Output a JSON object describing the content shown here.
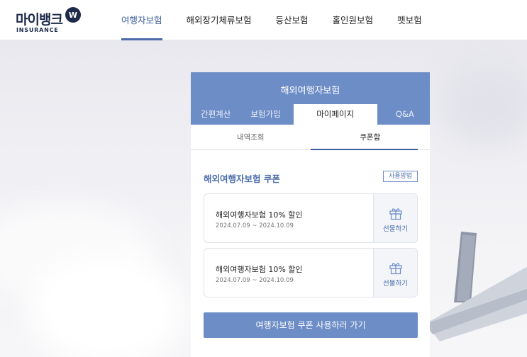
{
  "header": {
    "logo_text": "마이뱅크",
    "logo_sub": "INSURANCE",
    "logo_mark": "W",
    "nav": [
      {
        "label": "여행자보험"
      },
      {
        "label": "해외장기체류보험"
      },
      {
        "label": "등산보험"
      },
      {
        "label": "홀인원보험"
      },
      {
        "label": "펫보험"
      }
    ]
  },
  "card": {
    "title": "해외여행자보험",
    "tabs": [
      {
        "label": "간편계산"
      },
      {
        "label": "보험가입"
      },
      {
        "label": "마이페이지"
      },
      {
        "label": "Q&A"
      }
    ],
    "subtabs": [
      {
        "label": "내역조회"
      },
      {
        "label": "쿠폰함"
      }
    ],
    "section_title": "해외여행자보험 쿠폰",
    "how_to_use": "사용방법",
    "coupons": [
      {
        "name": "해외여행자보험 10% 할인",
        "period": "2024.07.09 ~ 2024.10.09",
        "gift_label": "선물하기",
        "icon": "gift-icon"
      },
      {
        "name": "해외여행자보험 10% 할인",
        "period": "2024.07.09 ~ 2024.10.09",
        "gift_label": "선물하기",
        "icon": "gift-icon"
      }
    ],
    "cta_label": "여행자보험 쿠폰 사용하러 가기"
  },
  "colors": {
    "accent": "#6d8dc7",
    "accent_dark": "#3d5c9e",
    "brand_navy": "#1d2a4a"
  }
}
